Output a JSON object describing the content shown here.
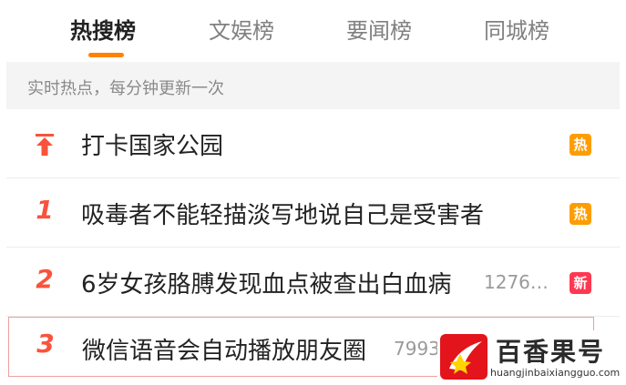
{
  "tabs": [
    {
      "label": "热搜榜",
      "active": true
    },
    {
      "label": "文娱榜",
      "active": false
    },
    {
      "label": "要闻榜",
      "active": false
    },
    {
      "label": "同城榜",
      "active": false
    }
  ],
  "subheader": "实时热点，每分钟更新一次",
  "rows": [
    {
      "rank_icon": "pin-top-icon",
      "title": "打卡国家公园",
      "badge": "热"
    },
    {
      "rank": "1",
      "title": "吸毒者不能轻描淡写地说自己是受害者",
      "badge": "热"
    },
    {
      "rank": "2",
      "title": "6岁女孩胳膊发现血点被查出白血病",
      "count": "1276…",
      "badge": "新"
    },
    {
      "rank": "3",
      "title": "微信语音会自动播放朋友圈",
      "count": "7993"
    }
  ],
  "colors": {
    "accent": "#ff8200",
    "rank": "#f8533c",
    "hot_badge": "#ff9d00",
    "new_badge": "#ff3852"
  },
  "watermark": {
    "title": "百香果号",
    "url": "huangjinbaixiangguo.com"
  }
}
